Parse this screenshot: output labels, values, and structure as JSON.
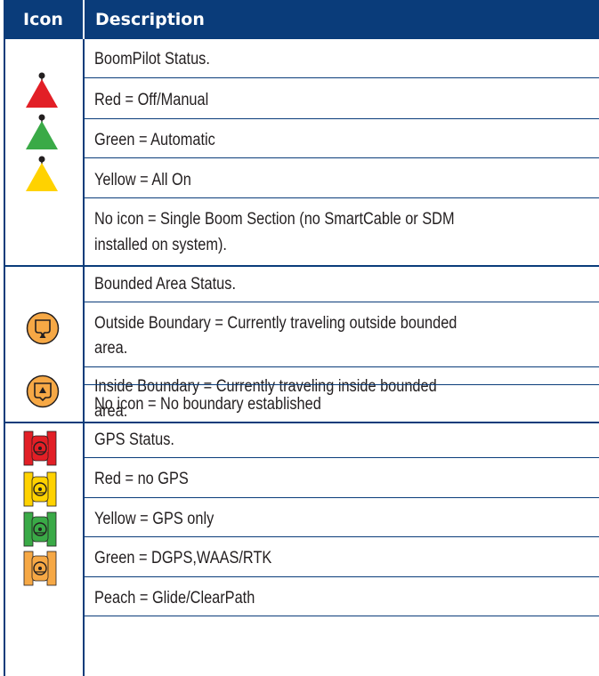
{
  "header": {
    "icon": "Icon",
    "description": "Description"
  },
  "boompilot": {
    "title": "BoomPilot Status.",
    "red": "Red = Off/Manual",
    "green": "Green = Automatic",
    "yellow": "Yellow = All On",
    "none_line1": "No icon = Single Boom Section (no SmartCable or SDM",
    "none_line2": "installed on system).",
    "icons": [
      "boompilot-red-triangle-icon",
      "boompilot-green-triangle-icon",
      "boompilot-yellow-triangle-icon"
    ],
    "colors": {
      "red": "#e21f26",
      "green": "#3aaa47",
      "yellow": "#ffd200"
    }
  },
  "bounded": {
    "title": "Bounded Area Status.",
    "outside_line1": "Outside Boundary = Currently traveling outside bounded",
    "outside_line2": "area.",
    "inside_line1": "Inside Boundary = Currently traveling inside bounded",
    "inside_line2": "area.",
    "none": "No icon = No boundary established",
    "icons": [
      "outside-boundary-icon",
      "inside-boundary-icon"
    ],
    "colors": {
      "fill": "#f6a845"
    }
  },
  "gps": {
    "title": "GPS Status.",
    "red": "Red = no GPS",
    "yellow": "Yellow = GPS only",
    "green": "Green = DGPS,WAAS/RTK",
    "peach": "Peach = Glide/ClearPath",
    "icons": [
      "gps-red-icon",
      "gps-yellow-icon",
      "gps-green-icon",
      "gps-peach-icon"
    ],
    "colors": {
      "red": "#e21f26",
      "yellow": "#ffd200",
      "green": "#3aaa47",
      "peach": "#f6a845"
    }
  }
}
